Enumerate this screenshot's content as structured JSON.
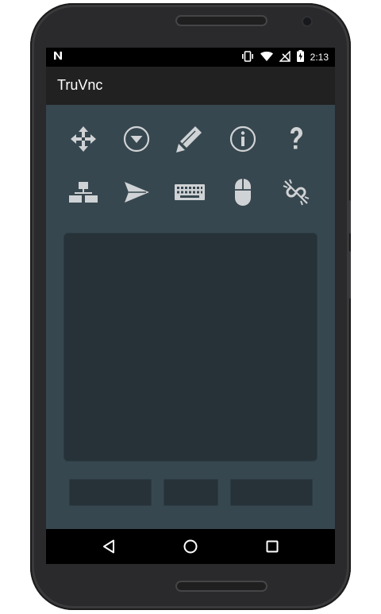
{
  "status_bar": {
    "notification_icon": "n-icon",
    "time": "2:13",
    "icons": [
      "vibrate-icon",
      "wifi-icon",
      "no-signal-icon",
      "battery-charging-icon"
    ]
  },
  "app_bar": {
    "title": "TruVnc"
  },
  "toolbar": {
    "row1": [
      "move-icon",
      "dropdown-circle-icon",
      "pencil-icon",
      "info-icon",
      "help-icon"
    ],
    "row2": [
      "network-icon",
      "send-icon",
      "keyboard-icon",
      "mouse-icon",
      "disconnect-icon"
    ]
  },
  "touchpad": {},
  "mouse_buttons": [
    "left-mouse-button",
    "middle-mouse-button",
    "right-mouse-button"
  ],
  "nav_bar": [
    "back-icon",
    "home-icon",
    "recents-icon"
  ],
  "colors": {
    "content_bg": "#37474f",
    "touchpad_bg": "#263238",
    "app_bar_bg": "#212121",
    "icon_color": "#d0d3d5"
  }
}
